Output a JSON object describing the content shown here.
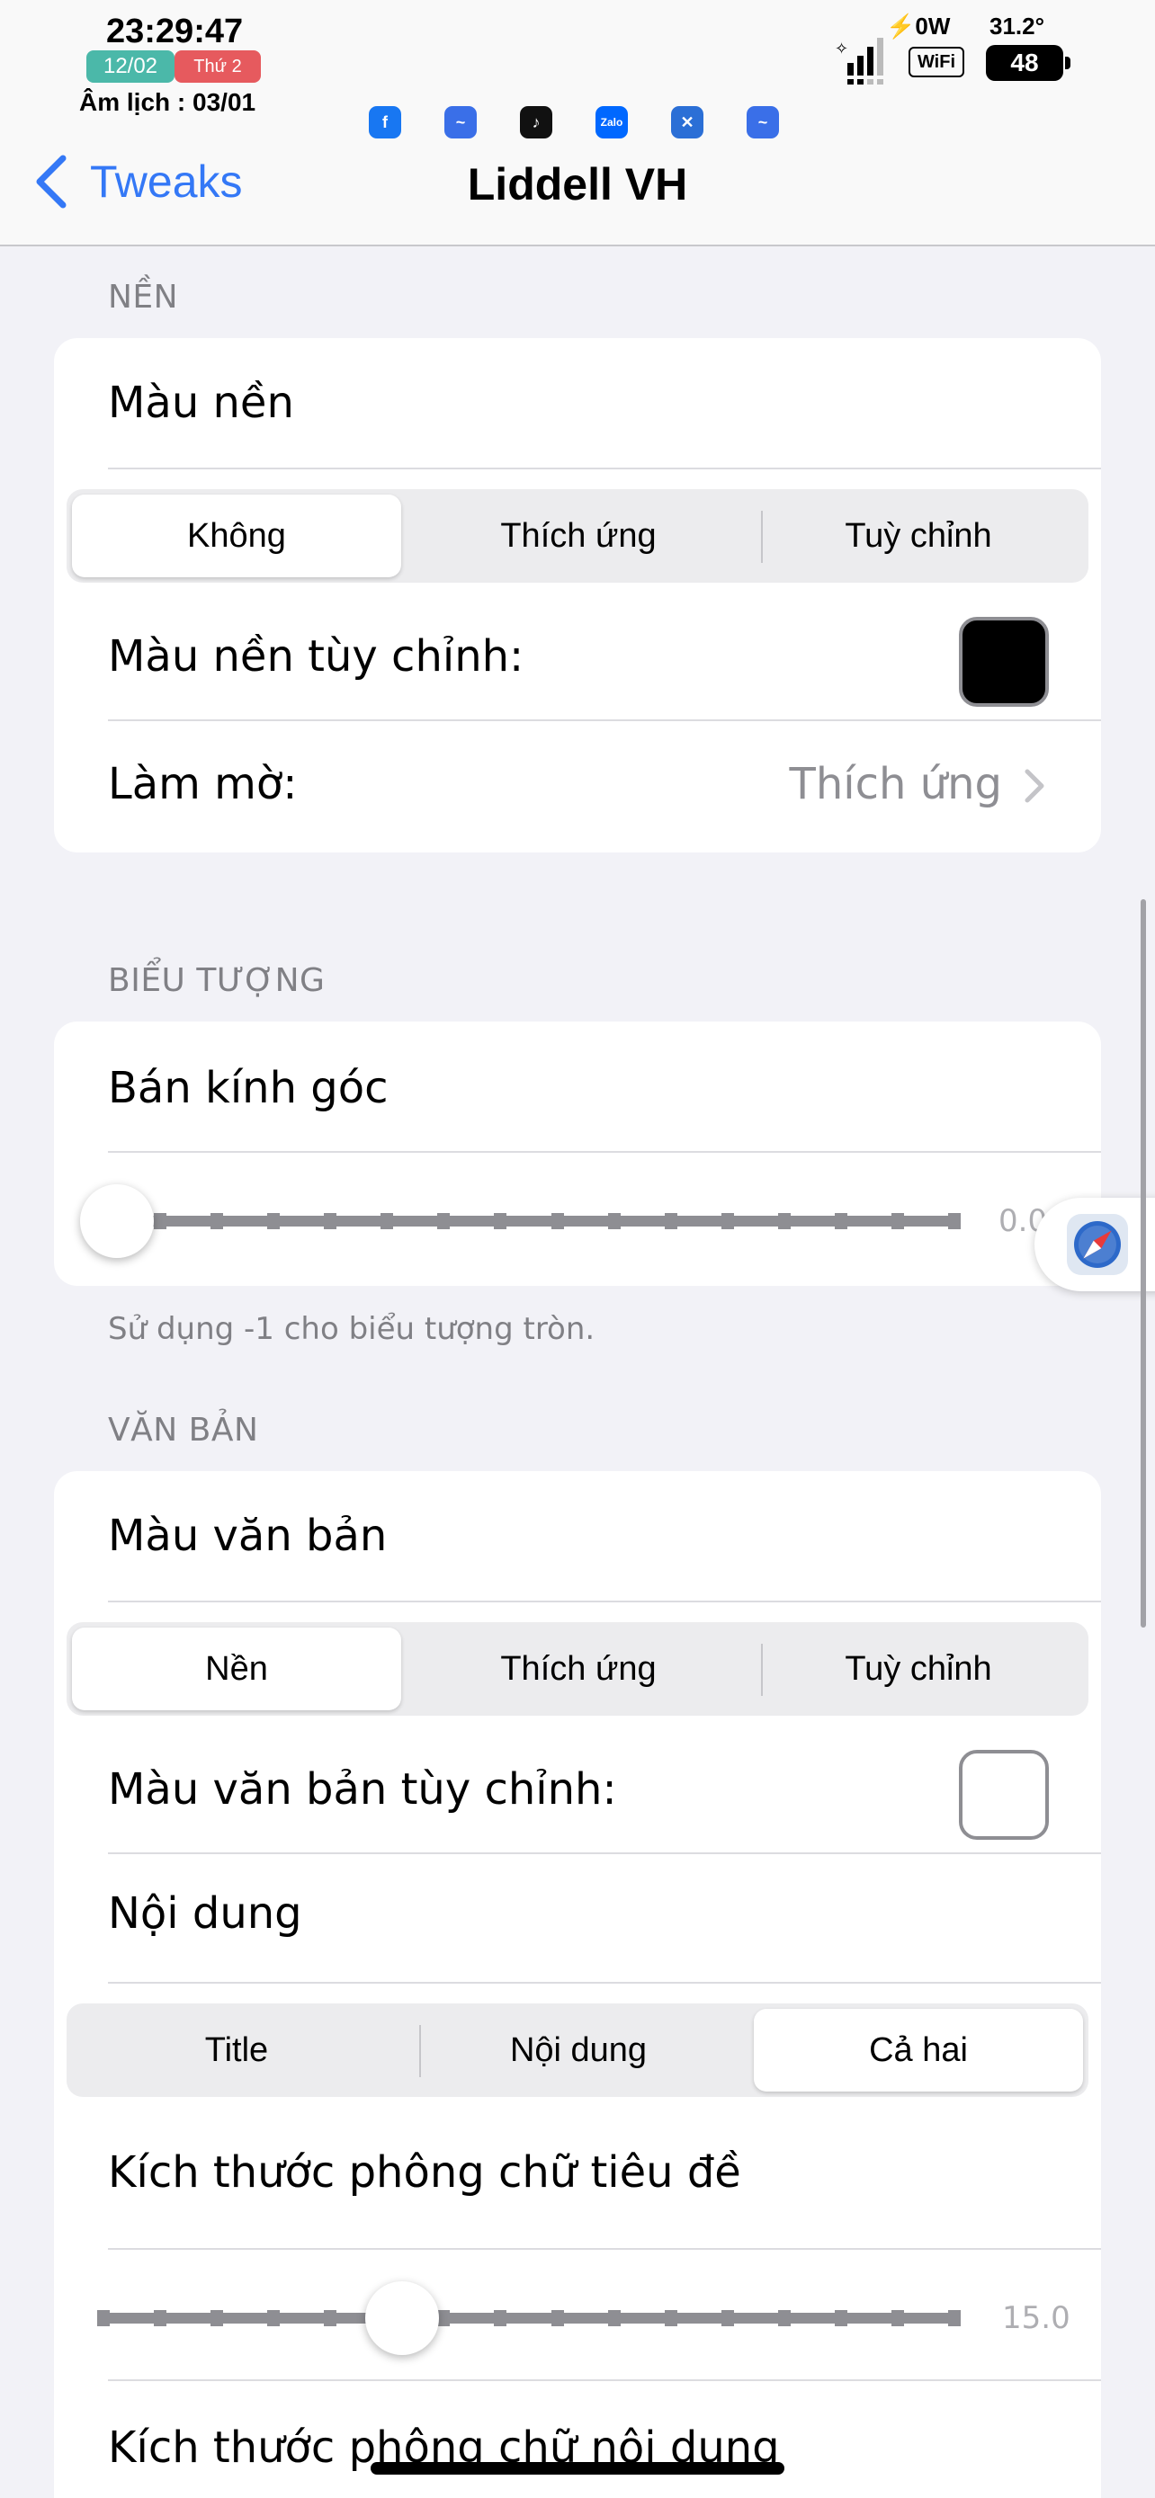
{
  "status_bar": {
    "time": "23:29:47",
    "date": "12/02",
    "weekday": "Thứ 2",
    "lunar": "Âm lịch : 03/01",
    "power": "⚡0W",
    "temperature": "31.2°",
    "wifi_label": "WiFi",
    "battery": "48",
    "notification_apps": [
      "facebook-icon",
      "messenger-icon",
      "tiktok-icon",
      "zalo-icon",
      "safari-icon",
      "messenger-icon"
    ],
    "zalo_label": "Zalo"
  },
  "nav": {
    "back_label": "Tweaks",
    "title": "Liddell VH",
    "accent": "#3478f6"
  },
  "background_section": {
    "header": "NỀN",
    "color_label": "Màu nền",
    "segments": [
      "Không",
      "Thích ứng",
      "Tuỳ chỉnh"
    ],
    "selected_segment": "Không",
    "custom_color_label": "Màu nền tùy chỉnh:",
    "custom_color_value": "#000000",
    "blur_label": "Làm mờ:",
    "blur_value": "Thích ứng"
  },
  "icon_section": {
    "header": "BIỂU TƯỢNG",
    "corner_radius_label": "Bán kính góc",
    "corner_radius_value": "0.0",
    "corner_radius_position": 0.0,
    "footer": "Sử dụng -1 cho biểu tượng tròn."
  },
  "text_section": {
    "header": "VĂN BẢN",
    "text_color_label": "Màu văn bản",
    "text_color_segments": [
      "Nền",
      "Thích ứng",
      "Tuỳ chỉnh"
    ],
    "text_color_selected": "Nền",
    "custom_text_color_label": "Màu văn bản tùy chỉnh:",
    "custom_text_color_value": "#ffffff",
    "content_label": "Nội dung",
    "content_segments": [
      "Title",
      "Nội dung",
      "Cả hai"
    ],
    "content_selected": "Cả hai",
    "title_font_size_label": "Kích thước phông chữ tiêu đề",
    "title_font_size_value": "15.0",
    "title_font_size_position": 0.33,
    "body_font_size_label": "Kích thước phông chữ nội dung"
  }
}
